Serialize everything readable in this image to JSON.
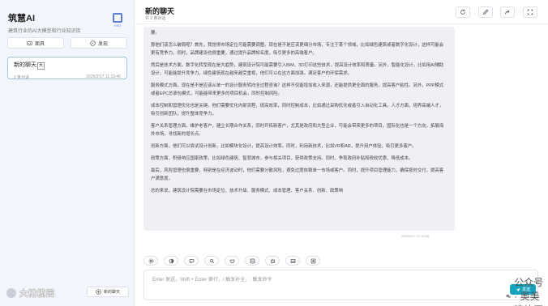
{
  "sidebar": {
    "app_name": "筑慧AI",
    "subtitle": "建筑行业的AI大模型和行业知识库",
    "logo_text": "FAO",
    "btn_faceview": "面具",
    "btn_discover": "发现",
    "conversation": {
      "title": "新的聊天",
      "tag": "大",
      "count": "2 条对话",
      "time": "2025/2/17 11:13:46"
    },
    "footer_watermark": "大橄榄园",
    "new_chat": "新的聊天"
  },
  "header": {
    "title": "新的聊天",
    "subtitle": "共 2 条对话"
  },
  "message": {
    "paragraphs": [
      "要。",
      "那他们该怎么破局呢？首先，我觉得市场定位可能需要调整。现在是不是应该更细分市场，专注于某个领域，比如绿色建筑或者数字化设计，这样可能会更有竞争力。同时，品牌建设也很重要，通过提升品牌知名度，吸引更多的高端客户。",
      "然后是技术方面，数字化转型现在是大趋势，建筑设计院可能需要引入BIM、3D打印这些技术，提高设计效率和质量。另外，智能化设计，比如用AI辅助设计，可能能提升竞争力。绿色建筑现在越来越受重视，他们可以在这方面加强，满足客户的环保需求。",
      "服务模式方面，现在是不是应该从单一的设计服务转向全过程咨询？这样不仅能增加收入来源，还能提供更全面的服务，提高客户粘性。另外，PPP模式或者EPC总承包模式，可能能带来更多的项目机会，同时控制风险。",
      "成本控制和管理优化也是关键。他们需要优化内部流程，提高效率，同时控制成本，比如通过采购优化或者引入自动化工具。人才方面，培养高端人才，吸引创新团队，提升整体竞争力。",
      "客户关系管理方面，维护老客户，建立长期合作关系，同时开拓新客户，尤其是政府和大型企业，可能会带来更多的项目。国际化也是一个方向，拓展海外市场，寻找新的增长点。",
      "创新方面，他们可以尝试设计创新，比如模块化设计，提高设计效率。同时，利用新技术，比如VR和AR，提升用户体验，吸引更多客户。",
      "政策方面，积极响应国家政策，比如绿色建筑、智慧城市，参与相关项目，获得政策支持。同时，争取政府补贴和税收优惠，降低成本。",
      "最后，风险管理也很重要，特别是在经济波动时，他们需要分散风险，避免过度依赖单一市场或客户。同时，提升项目管理能力，确保按时交付，提高客户满意度。",
      "总的来说，建筑设计院需要在市场定位、技术升级、服务模式、成本管理、客户关系、创新、政策响"
    ],
    "time": "2025/2/17 11:13:46"
  },
  "input": {
    "placeholder": "Enter 发送，Shift + Enter 换行，/ 触发补全，: 触发命令",
    "send_label": "发送"
  },
  "watermark": {
    "text": "公众号 · 奥美建筑网"
  },
  "colors": {
    "accent": "#16a3bd",
    "sidebar_bg": "#f2f5fb",
    "bubble_bg": "#eef0f3"
  }
}
